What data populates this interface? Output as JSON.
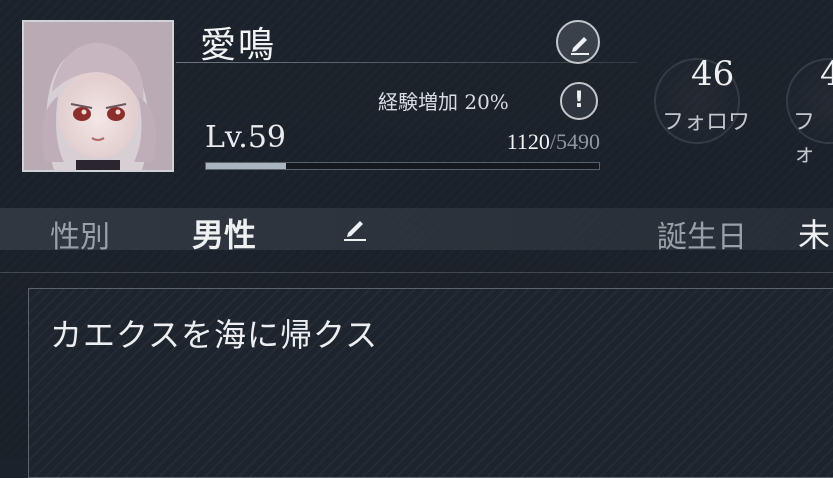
{
  "profile": {
    "name": "愛鳴",
    "exp_bonus_label": "経験増加 20%",
    "warning_icon_glyph": "!",
    "level": "Lv.59",
    "exp_current": "1120",
    "exp_separator": "/",
    "exp_max": "5490",
    "exp_progress": 0.204
  },
  "stats": [
    {
      "value": "46",
      "label": "フォロワ"
    },
    {
      "value": "4",
      "label": "フォ"
    }
  ],
  "fields": {
    "gender_label": "性別",
    "gender_value": "男性",
    "birthday_label": "誕生日",
    "birthday_value": "未"
  },
  "bio": {
    "text": "カエクスを海に帰クス"
  },
  "icons": {
    "edit_profile": "pencil-icon",
    "edit_gender": "pencil-icon",
    "exp_info": "exclamation-icon"
  },
  "colors": {
    "background": "#1c222b",
    "xp_fill": "#a9b6c2",
    "text_primary": "#eef0f2",
    "text_muted": "#9aa0a8"
  }
}
